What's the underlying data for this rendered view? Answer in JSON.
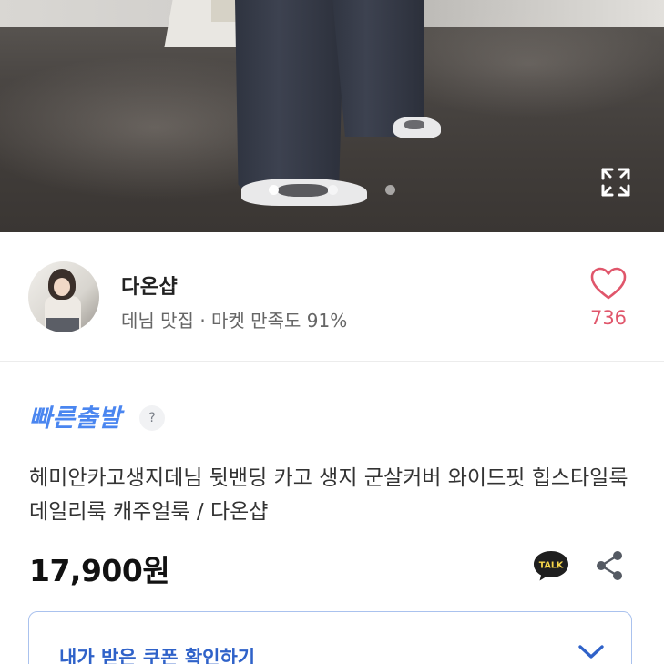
{
  "gallery": {
    "dot_count": 3,
    "active_dot": 0,
    "expand_icon": "expand-icon"
  },
  "seller": {
    "name": "다온샵",
    "subtitle": "데님 맛집 · 마켓 만족도 91%",
    "likes": "736",
    "heart_icon": "heart-icon",
    "accent_color": "#e0566b"
  },
  "shipping": {
    "label": "빠른출발",
    "help": "?",
    "color": "#4a86f0"
  },
  "product": {
    "title": "헤미안카고생지데님 뒷밴딩 카고 생지 군살커버 와이드핏 힙스타일룩 데일리룩 캐주얼룩 / 다온샵",
    "price": "17,900원",
    "talk_label": "TALK",
    "share_icon": "share-icon"
  },
  "coupon": {
    "label": "내가 받은 쿠폰 확인하기",
    "chevron_icon": "chevron-down-icon",
    "color": "#2f62c9"
  }
}
